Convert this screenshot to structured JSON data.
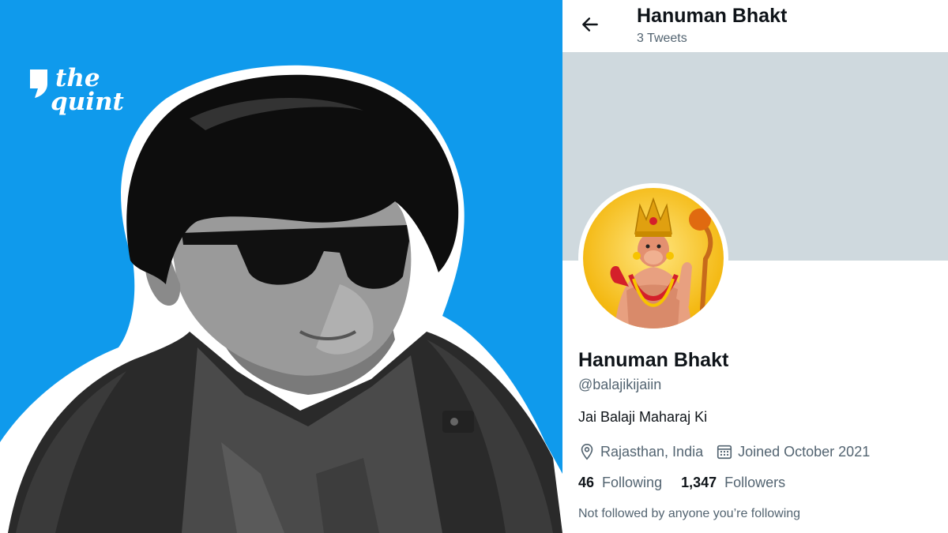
{
  "brand": {
    "line1": "the",
    "line2": "quint"
  },
  "colors": {
    "left_bg": "#0F9AEC",
    "banner": "#CFD9DE",
    "text_primary": "#0f1419",
    "text_secondary": "#536471"
  },
  "header": {
    "name": "Hanuman Bhakt",
    "tweet_count": "3 Tweets",
    "back_icon": "arrow-left-icon"
  },
  "profile": {
    "display_name": "Hanuman Bhakt",
    "handle": "@balajikijaiin",
    "bio": "Jai Balaji Maharaj Ki",
    "location": "Rajasthan, India",
    "location_icon": "location-pin-icon",
    "joined": "Joined October 2021",
    "joined_icon": "calendar-icon",
    "following_count": "46",
    "following_label": "Following",
    "followers_count": "1,347",
    "followers_label": "Followers",
    "not_followed_note": "Not followed by anyone you’re following"
  }
}
